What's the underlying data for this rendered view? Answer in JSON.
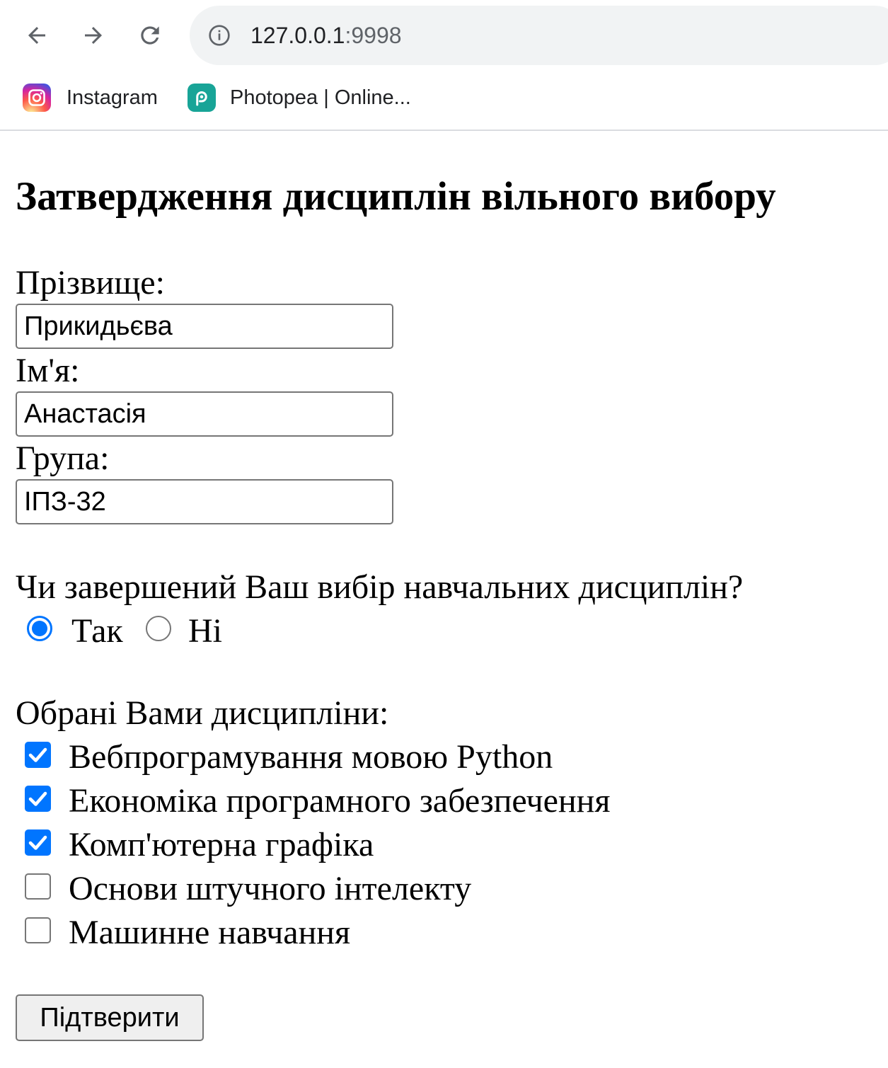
{
  "browser": {
    "url_host": "127.0.0.1",
    "url_port": ":9998",
    "nav_icons": [
      "back-arrow-icon",
      "forward-arrow-icon",
      "reload-icon",
      "info-icon"
    ],
    "bookmarks": [
      {
        "label": "Instagram",
        "icon": "instagram-icon"
      },
      {
        "label": "Photopea | Online...",
        "icon": "photopea-icon"
      }
    ]
  },
  "form": {
    "title": "Затвердження дисциплін вільного вибору",
    "surname_label": "Прізвище:",
    "surname_value": "Прикидьєва",
    "name_label": "Ім'я:",
    "name_value": "Анастасія",
    "group_label": "Група:",
    "group_value": "ІПЗ-32",
    "question": "Чи завершений Ваш вибір навчальних дисциплін?",
    "choice": {
      "options": [
        {
          "label": "Так",
          "selected": true
        },
        {
          "label": "Ні",
          "selected": false
        }
      ]
    },
    "courses_label": "Обрані Вами дисципліни:",
    "courses": [
      {
        "label": "Вебпрограмування мовою Python",
        "checked": true
      },
      {
        "label": "Економіка програмного забезпечення",
        "checked": true
      },
      {
        "label": "Комп'ютерна графіка",
        "checked": true
      },
      {
        "label": "Основи штучного інтелекту",
        "checked": false
      },
      {
        "label": "Машинне навчання",
        "checked": false
      }
    ],
    "submit_label": "Підтверити"
  },
  "colors": {
    "accent": "#0075ff",
    "omnibox_bg": "#f1f3f4",
    "control_border": "#767676"
  }
}
